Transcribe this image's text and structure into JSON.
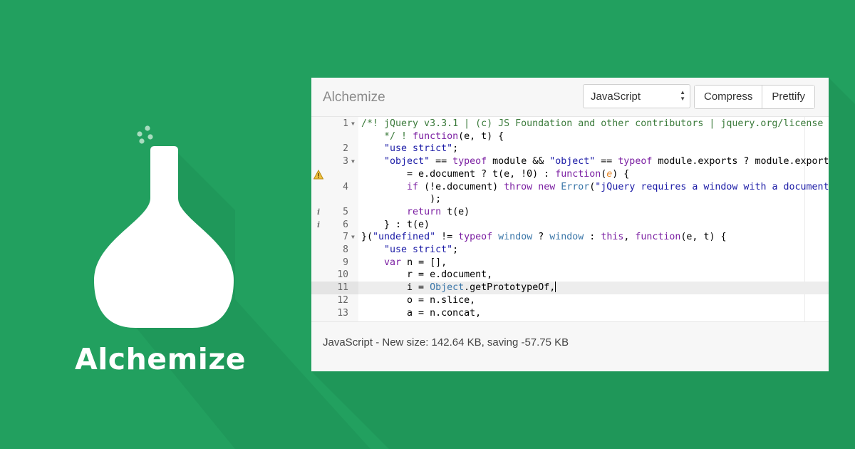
{
  "brand": {
    "name": "Alchemize",
    "colors": {
      "background": "#22a05f",
      "flask": "#ffffff"
    }
  },
  "window": {
    "title": "Alchemize",
    "language_select": {
      "selected": "JavaScript"
    },
    "buttons": {
      "compress": "Compress",
      "prettify": "Prettify"
    },
    "editor": {
      "active_line": 11,
      "lines": [
        {
          "num": "1",
          "fold": true,
          "marker": ""
        },
        {
          "num": "",
          "fold": false,
          "marker": ""
        },
        {
          "num": "2",
          "fold": false,
          "marker": ""
        },
        {
          "num": "3",
          "fold": true,
          "marker": ""
        },
        {
          "num": "",
          "fold": false,
          "marker": "warning"
        },
        {
          "num": "4",
          "fold": false,
          "marker": ""
        },
        {
          "num": "",
          "fold": false,
          "marker": ""
        },
        {
          "num": "5",
          "fold": false,
          "marker": "info"
        },
        {
          "num": "6",
          "fold": false,
          "marker": "info"
        },
        {
          "num": "7",
          "fold": true,
          "marker": ""
        },
        {
          "num": "8",
          "fold": false,
          "marker": ""
        },
        {
          "num": "9",
          "fold": false,
          "marker": ""
        },
        {
          "num": "10",
          "fold": false,
          "marker": ""
        },
        {
          "num": "11",
          "fold": false,
          "marker": ""
        },
        {
          "num": "12",
          "fold": false,
          "marker": ""
        },
        {
          "num": "13",
          "fold": false,
          "marker": ""
        }
      ],
      "code": [
        [
          [
            "cm",
            "/*! jQuery v3.3.1 | (c) JS Foundation and other contributors | jquery.org/license"
          ]
        ],
        [
          [
            "pl",
            "    "
          ],
          [
            "cm",
            "*/ ! "
          ],
          [
            "kw",
            "function"
          ],
          [
            "pl",
            "(e, t) {"
          ]
        ],
        [
          [
            "pl",
            "    "
          ],
          [
            "st",
            "\"use strict\""
          ],
          [
            "pl",
            ";"
          ]
        ],
        [
          [
            "pl",
            "    "
          ],
          [
            "st",
            "\"object\""
          ],
          [
            "pl",
            " == "
          ],
          [
            "kw",
            "typeof"
          ],
          [
            "pl",
            " module && "
          ],
          [
            "st",
            "\"object\""
          ],
          [
            "pl",
            " == "
          ],
          [
            "kw",
            "typeof"
          ],
          [
            "pl",
            " module.exports ? module.exports"
          ]
        ],
        [
          [
            "pl",
            "        = e.document ? t(e, !0) : "
          ],
          [
            "kw",
            "function"
          ],
          [
            "pl",
            "("
          ],
          [
            "pa",
            "e"
          ],
          [
            "pl",
            ") {"
          ]
        ],
        [
          [
            "pl",
            "        "
          ],
          [
            "kw",
            "if"
          ],
          [
            "pl",
            " (!e.document) "
          ],
          [
            "kw",
            "throw"
          ],
          [
            "pl",
            " "
          ],
          [
            "kw",
            "new"
          ],
          [
            "pl",
            " "
          ],
          [
            "bi",
            "Error"
          ],
          [
            "pl",
            "("
          ],
          [
            "st",
            "\"jQuery requires a window with a document\""
          ]
        ],
        [
          [
            "pl",
            "            );"
          ]
        ],
        [
          [
            "pl",
            "        "
          ],
          [
            "kw",
            "return"
          ],
          [
            "pl",
            " t(e)"
          ]
        ],
        [
          [
            "pl",
            "    } : t(e)"
          ]
        ],
        [
          [
            "pl",
            "}("
          ],
          [
            "st",
            "\"undefined\""
          ],
          [
            "pl",
            " != "
          ],
          [
            "kw",
            "typeof"
          ],
          [
            "pl",
            " "
          ],
          [
            "ob",
            "window"
          ],
          [
            "pl",
            " ? "
          ],
          [
            "ob",
            "window"
          ],
          [
            "pl",
            " : "
          ],
          [
            "kw",
            "this"
          ],
          [
            "pl",
            ", "
          ],
          [
            "kw",
            "function"
          ],
          [
            "pl",
            "(e, t) {"
          ]
        ],
        [
          [
            "pl",
            "    "
          ],
          [
            "st",
            "\"use strict\""
          ],
          [
            "pl",
            ";"
          ]
        ],
        [
          [
            "pl",
            "    "
          ],
          [
            "kw",
            "var"
          ],
          [
            "pl",
            " n = [],"
          ]
        ],
        [
          [
            "pl",
            "        r = e.document,"
          ]
        ],
        [
          [
            "pl",
            "        i = "
          ],
          [
            "ob",
            "Object"
          ],
          [
            "pl",
            ".getPrototypeOf,"
          ]
        ],
        [
          [
            "pl",
            "        o = n.slice,"
          ]
        ],
        [
          [
            "pl",
            "        a = n.concat,"
          ]
        ]
      ]
    },
    "status": "JavaScript - New size: 142.64 KB, saving -57.75 KB"
  }
}
